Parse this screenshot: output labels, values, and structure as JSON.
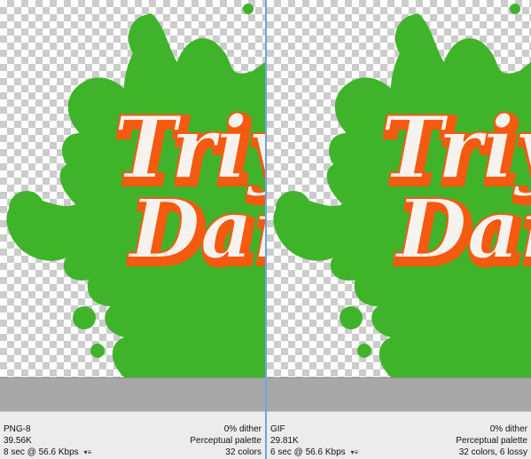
{
  "panes": [
    {
      "format": "PNG-8",
      "size": "39.56K",
      "download": "8 sec @ 56.6 Kbps",
      "dither": "0% dither",
      "palette": "Perceptual palette",
      "colors": "32 colors"
    },
    {
      "format": "GIF",
      "size": "29.81K",
      "download": "6 sec @ 56.6 Kbps",
      "dither": "0% dither",
      "palette": "Perceptual palette",
      "colors_lossy": "32 colors, 6 lossy"
    }
  ],
  "artwork": {
    "text_line1": "Triy",
    "text_line2": "Dar"
  },
  "colors": {
    "splash_green": "#3fb42a",
    "outline_orange": "#f45a10",
    "letter_white": "#f6f2ee",
    "divider_blue": "#6aa7e0"
  }
}
